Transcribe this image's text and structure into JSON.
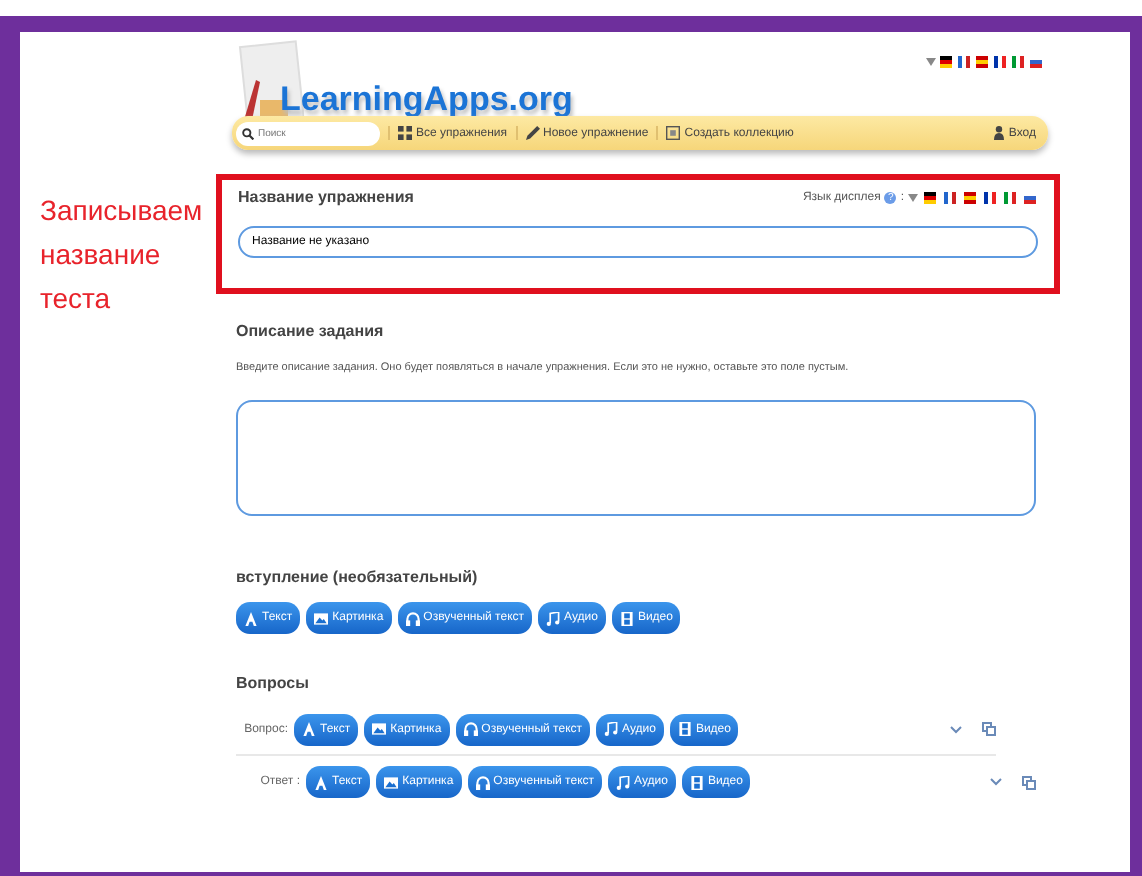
{
  "header": {
    "logo": "LearningApps.org",
    "search": {
      "placeholder": "Поиск"
    },
    "nav": [
      {
        "label": "Все упражнения",
        "kind": "grid"
      },
      {
        "label": "Новое упражнение",
        "kind": "pencil"
      },
      {
        "label": "Создать коллекцию",
        "kind": "collection"
      }
    ],
    "login": "Вход"
  },
  "annotation": "Записываем название теста",
  "title_section": {
    "heading": "Название упражнения",
    "display_language": "Язык дисплея",
    "help": "?",
    "separator": ":",
    "value": "Название не указано"
  },
  "description": {
    "heading": "Описание задания",
    "hint": "Введите описание задания. Оно будет появляться в начале упражнения. Если это не нужно, оставьте это поле пустым."
  },
  "intro": {
    "heading": "вступление (необязательный)",
    "buttons": [
      {
        "label": "Текст",
        "kind": "text"
      },
      {
        "label": "Картинка",
        "kind": "image"
      },
      {
        "label": "Озвученный текст",
        "kind": "voice"
      },
      {
        "label": "Аудио",
        "kind": "audio"
      },
      {
        "label": "Видео",
        "kind": "video"
      }
    ]
  },
  "questions": {
    "heading": "Вопросы",
    "rows": [
      {
        "label": "Вопрос:",
        "buttons": [
          {
            "label": "Текст",
            "kind": "text"
          },
          {
            "label": "Картинка",
            "kind": "image"
          },
          {
            "label": "Озвученный текст",
            "kind": "voice"
          },
          {
            "label": "Аудио",
            "kind": "audio"
          },
          {
            "label": "Видео",
            "kind": "video"
          }
        ]
      },
      {
        "label": "Ответ :",
        "buttons": [
          {
            "label": "Текст",
            "kind": "text"
          },
          {
            "label": "Картинка",
            "kind": "image"
          },
          {
            "label": "Озвученный текст",
            "kind": "voice"
          },
          {
            "label": "Аудио",
            "kind": "audio"
          },
          {
            "label": "Видео",
            "kind": "video"
          }
        ]
      }
    ]
  }
}
